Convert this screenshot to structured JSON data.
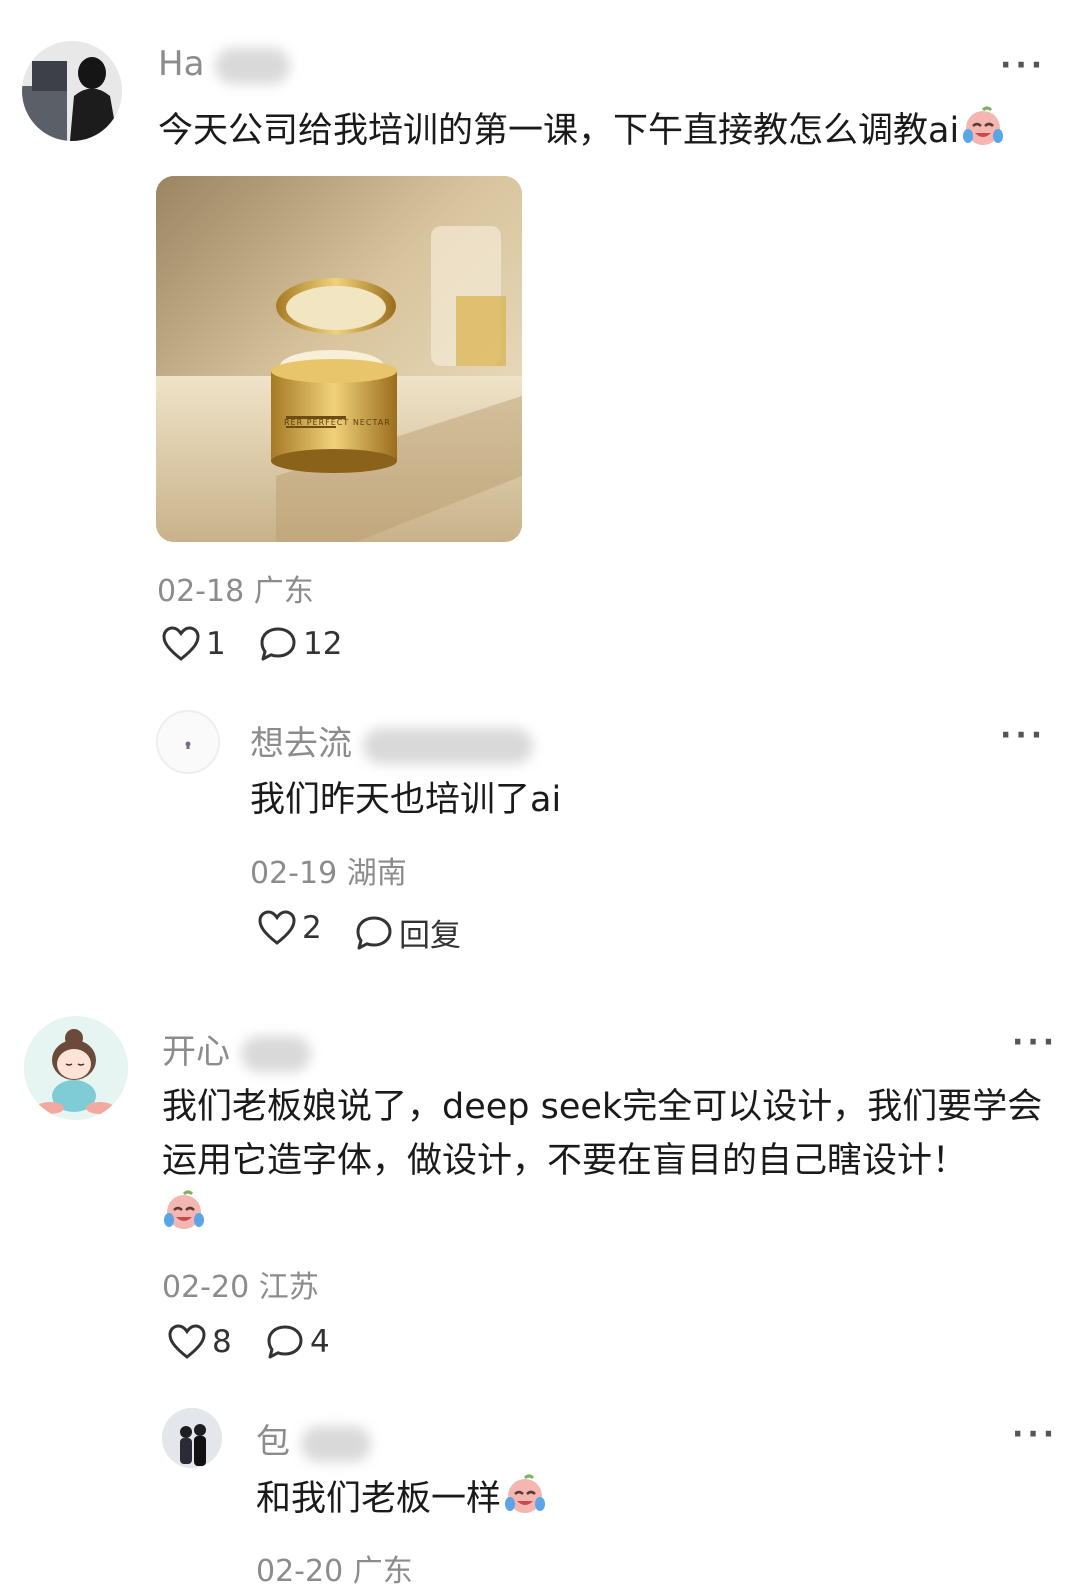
{
  "comments": [
    {
      "name": "Ha",
      "text": "今天公司给我培训的第一课，下午直接教怎么调教ai",
      "date_location": "02-18 广东",
      "likes": "1",
      "replies": "12",
      "image_caption": "RER PERFECT NECTAR",
      "reply": {
        "name": "想去流",
        "text": "我们昨天也培训了ai",
        "date_location": "02-19 湖南",
        "likes": "2",
        "reply_label": "回复"
      }
    },
    {
      "name": "开心",
      "text": "我们老板娘说了，deep seek完全可以设计，我们要学会运用它造字体，做设计，不要在盲目的自己瞎设计！",
      "date_location": "02-20 江苏",
      "likes": "8",
      "replies": "4",
      "reply": {
        "name": "包",
        "text": "和我们老板一样",
        "date_location": "02-20 广东"
      }
    }
  ],
  "more_label": "···",
  "icons": {
    "like": "heart-outline-icon",
    "comment": "speech-bubble-icon",
    "emoji": "crying-laughing-emoji-icon"
  },
  "colors": {
    "meta_text": "#8c8c8c",
    "body_text": "#1a1a1a",
    "emoji_face": "#f4b6b0"
  }
}
